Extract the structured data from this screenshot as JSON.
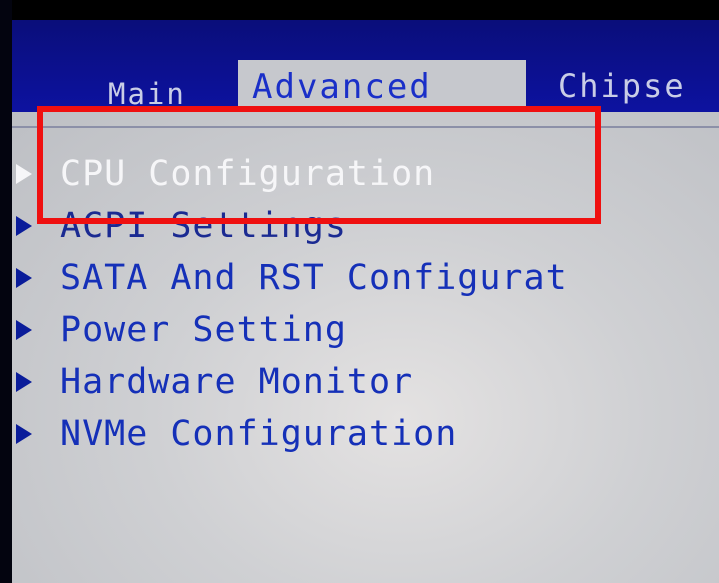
{
  "tabs": {
    "main": "Main",
    "advanced": "Advanced",
    "chipset": "Chipse"
  },
  "menu": {
    "items": [
      {
        "label": "CPU Configuration",
        "state": "selected"
      },
      {
        "label": "ACPI Settings",
        "state": "partially-obscured"
      },
      {
        "label": "SATA And RST Configurat",
        "state": "normal"
      },
      {
        "label": "Power Setting",
        "state": "normal"
      },
      {
        "label": "Hardware Monitor",
        "state": "normal"
      },
      {
        "label": "NVMe Configuration",
        "state": "normal"
      }
    ]
  },
  "colors": {
    "tab_strip": "#0d12a0",
    "panel": "#cfd0d3",
    "item_text": "#1530b8",
    "selected_text": "#f6f6f8",
    "highlight_box": "#ef1010"
  },
  "icons": {
    "submenu": "triangle-right-icon"
  }
}
